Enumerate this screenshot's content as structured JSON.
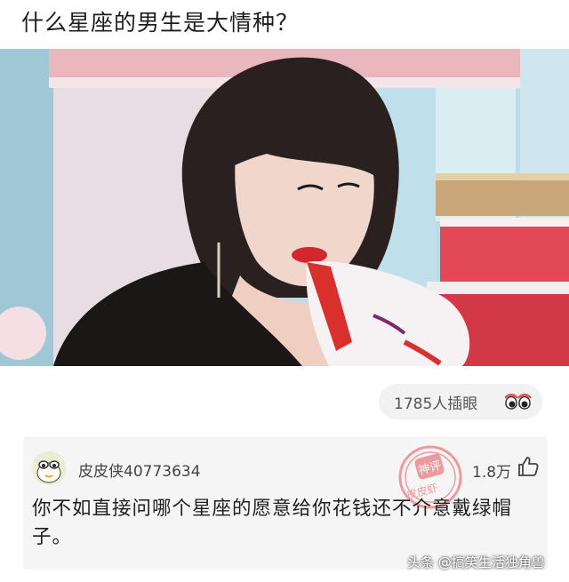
{
  "post": {
    "title": "什么星座的男生是大情种？"
  },
  "reaction": {
    "count_text": "1785人插眼",
    "icon": "eyes-icon"
  },
  "comment": {
    "username": "皮皮侠40773634",
    "likes": "1.8万",
    "text": "你不如直接问哪个星座的愿意给你花钱还不介意戴绿帽子。",
    "stamp_line1": "神评",
    "stamp_line2": "皮皮虾"
  },
  "watermark": {
    "text": "头条 @搞笑生活独角兽"
  },
  "colors": {
    "stamp_red": "#e8505a",
    "pill_bg": "#f2f2f2",
    "card_bg": "#f5f5f5"
  }
}
